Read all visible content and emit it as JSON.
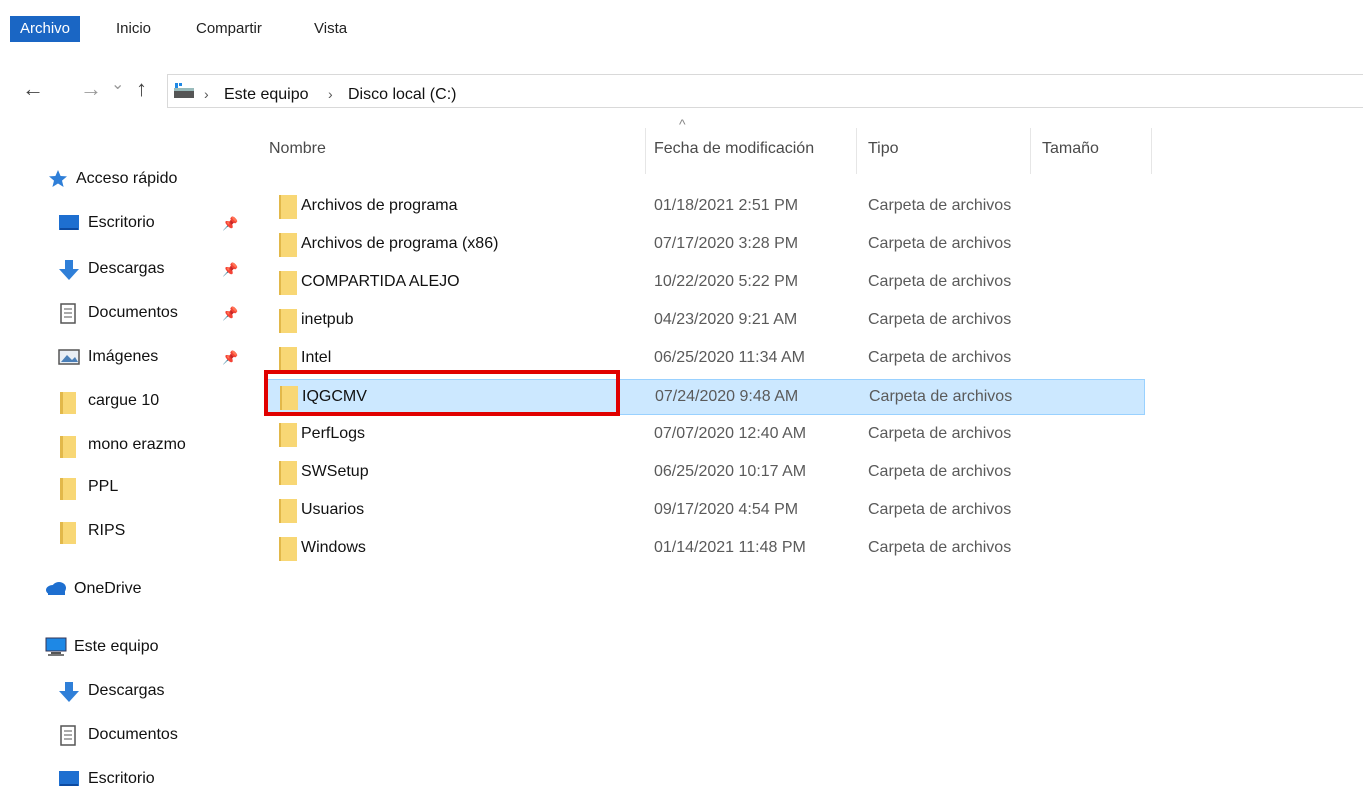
{
  "ribbon": {
    "tabs": [
      "Archivo",
      "Inicio",
      "Compartir",
      "Vista"
    ]
  },
  "nav": {
    "back": "←",
    "forward": "→",
    "recent": "⌄",
    "up": "↑"
  },
  "address": {
    "crumbs": [
      "Este equipo",
      "Disco local (C:)"
    ],
    "separator": "›"
  },
  "sidebar": {
    "items": [
      {
        "label": "Acceso rápido",
        "icon": "star-icon",
        "pinned": false
      },
      {
        "label": "Escritorio",
        "icon": "desktop-icon",
        "pinned": true
      },
      {
        "label": "Descargas",
        "icon": "download-arrow-icon",
        "pinned": true
      },
      {
        "label": "Documentos",
        "icon": "document-icon",
        "pinned": true
      },
      {
        "label": "Imágenes",
        "icon": "image-icon",
        "pinned": true
      },
      {
        "label": "cargue 10",
        "icon": "folder-icon",
        "pinned": false
      },
      {
        "label": "mono erazmo",
        "icon": "folder-icon",
        "pinned": false
      },
      {
        "label": "PPL",
        "icon": "folder-icon",
        "pinned": false
      },
      {
        "label": "RIPS",
        "icon": "folder-icon",
        "pinned": false
      },
      {
        "label": "OneDrive",
        "icon": "cloud-icon",
        "pinned": false
      },
      {
        "label": "Este equipo",
        "icon": "computer-icon",
        "pinned": false
      },
      {
        "label": "Descargas",
        "icon": "download-arrow-icon",
        "pinned": false
      },
      {
        "label": "Documentos",
        "icon": "document-icon",
        "pinned": false
      },
      {
        "label": "Escritorio",
        "icon": "desktop-icon",
        "pinned": false
      }
    ],
    "pin_glyph": "📌"
  },
  "list": {
    "sort_glyph": "^",
    "columns": [
      "Nombre",
      "Fecha de modificación",
      "Tipo",
      "Tamaño"
    ],
    "rows": [
      {
        "name": "Archivos de programa",
        "date": "01/18/2021 2:51 PM",
        "type": "Carpeta de archivos"
      },
      {
        "name": "Archivos de programa (x86)",
        "date": "07/17/2020 3:28 PM",
        "type": "Carpeta de archivos"
      },
      {
        "name": "COMPARTIDA ALEJO",
        "date": "10/22/2020 5:22 PM",
        "type": "Carpeta de archivos"
      },
      {
        "name": "inetpub",
        "date": "04/23/2020 9:21 AM",
        "type": "Carpeta de archivos"
      },
      {
        "name": "Intel",
        "date": "06/25/2020 11:34 AM",
        "type": "Carpeta de archivos"
      },
      {
        "name": "IQGCMV",
        "date": "07/24/2020 9:48 AM",
        "type": "Carpeta de archivos",
        "selected": true
      },
      {
        "name": "PerfLogs",
        "date": "07/07/2020 12:40 AM",
        "type": "Carpeta de archivos"
      },
      {
        "name": "SWSetup",
        "date": "06/25/2020 10:17 AM",
        "type": "Carpeta de archivos"
      },
      {
        "name": "Usuarios",
        "date": "09/17/2020 4:54 PM",
        "type": "Carpeta de archivos"
      },
      {
        "name": "Windows",
        "date": "01/14/2021 11:48 PM",
        "type": "Carpeta de archivos"
      }
    ]
  },
  "colors": {
    "accent": "#1a66c4",
    "selection": "#cce8ff",
    "highlight_box": "#e00000",
    "folder": "#f8d775"
  }
}
